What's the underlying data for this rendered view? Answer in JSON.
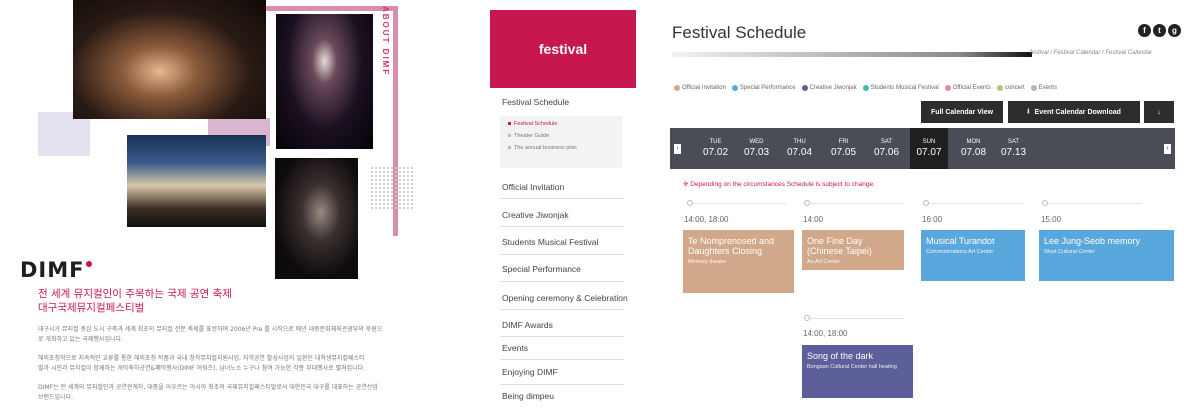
{
  "promo": {
    "about_label": "ABOUT DIMF",
    "logo_text": "DIMF",
    "title_line1": "전 세계 뮤지컬인이 주목하는 국제 공연 축제",
    "title_line2": "대구국제뮤지컬페스티벌",
    "paragraphs": [
      "대구시가 뮤지컬 중심 도시 구축과 세계 최초의 뮤지컬 전문 축제를 표방하며 2006년 Pre 를 시작으로 매년 대중문화체육관광부의 후원으",
      "로 개최하고 있는 국제행사입니다.",
      "해외초청작으로 지속적인 교류를 통한 해외초청 작품과 국내 창작뮤지컬지원사업, 지역공연 활성사업의 일환인 대학생뮤지컬페스티",
      "벌과 시민과 뮤지컬이 함께하는 개막축하공연&폐막행사(DIMF 어워즈), 남녀노소 누구나 참여 가능한 각종 부대행사로 펼쳐집니다.",
      "DIMF는 전 세계의 뮤지컬인과 공연관계자, 대중을 아우르는 아시아 최초의 국제뮤지컬페스티벌로서 대한민국 대구를 대표하는 공연산업",
      "브랜드입니다."
    ]
  },
  "sidebar": {
    "header": "festival",
    "current": "Festival Schedule",
    "sub_items": [
      "Festival Schedule",
      "Theater Guide",
      "The annual business plan"
    ],
    "items": [
      "Official Invitation",
      "Creative Jiwonjak",
      "Students Musical Festival",
      "Special Performance",
      "Opening ceremony & Celebration",
      "DIMF Awards",
      "Events",
      "Enjoying DIMF",
      "Being dimpeu"
    ]
  },
  "main": {
    "title": "Festival Schedule",
    "breadcrumb": "festival / Festival Calendar / Festival Calendar",
    "social": [
      "f",
      "t",
      "g"
    ],
    "legend": [
      {
        "label": "Official Invitation",
        "color": "#d2a88a"
      },
      {
        "label": "Special Performance",
        "color": "#5aa7dd"
      },
      {
        "label": "Creative Jiwonjak",
        "color": "#5c5f99"
      },
      {
        "label": "Students Musical Festival",
        "color": "#3fbfa8"
      },
      {
        "label": "Official Events",
        "color": "#e58aa2"
      },
      {
        "label": "concert",
        "color": "#a8c87f"
      },
      {
        "label": "Events",
        "color": "#b5b5b5"
      }
    ],
    "buttons": {
      "full_calendar": "Full Calendar View",
      "download": "Event Calendar Download",
      "extra_icon": "↓"
    },
    "dates": [
      {
        "dow": "TUE",
        "date": "07.02"
      },
      {
        "dow": "WED",
        "date": "07.03"
      },
      {
        "dow": "THU",
        "date": "07.04"
      },
      {
        "dow": "FRI",
        "date": "07.05"
      },
      {
        "dow": "SAT",
        "date": "07.06"
      },
      {
        "dow": "SUN",
        "date": "07.07"
      },
      {
        "dow": "MON",
        "date": "07.08"
      },
      {
        "dow": "SAT",
        "date": "07.13"
      }
    ],
    "notice": "※ Depending on the circumstances Schedule is subject to change.",
    "times": [
      "14:00, 18:00",
      "14:00",
      "16:00",
      "15:00",
      "14:00, 18:00"
    ],
    "events": [
      {
        "title": "Te Nomprenosed and Daughters Closing",
        "venue": "Memory theater",
        "color": "#d2a88a"
      },
      {
        "title": "One Fine Day (Chinese Taipei)",
        "venue": "Au Art Center",
        "color": "#d2a88a"
      },
      {
        "title": "Musical Turandot",
        "venue": "Communications Art Center",
        "color": "#5aa7dd"
      },
      {
        "title": "Lee Jung-Seob memory",
        "venue": "West Cultural Center",
        "color": "#5aa7dd"
      },
      {
        "title": "Song of the dark",
        "venue": "Bongsan Cultural Center hall heating",
        "color": "#5c5f99"
      }
    ]
  }
}
